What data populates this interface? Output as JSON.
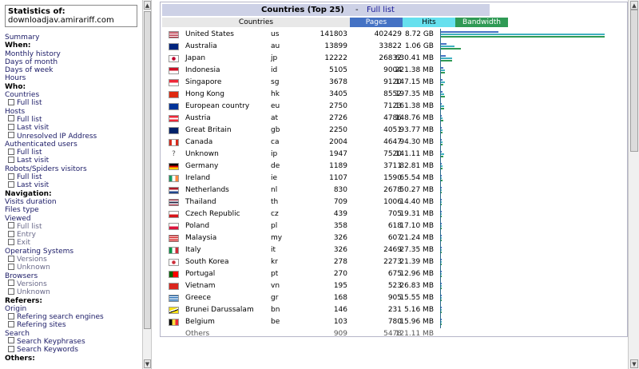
{
  "sidebar": {
    "stats_label": "Statistics of:",
    "site": "downloadjav.amirariff.com",
    "items": [
      {
        "type": "lk",
        "text": "Summary"
      },
      {
        "type": "hd",
        "text": "When:"
      },
      {
        "type": "lk",
        "text": "Monthly history"
      },
      {
        "type": "lk",
        "text": "Days of month"
      },
      {
        "type": "lk",
        "text": "Days of week"
      },
      {
        "type": "lk",
        "text": "Hours"
      },
      {
        "type": "hd",
        "text": "Who:"
      },
      {
        "type": "lk",
        "text": "Countries"
      },
      {
        "type": "sub",
        "text": "Full list"
      },
      {
        "type": "lk",
        "text": "Hosts"
      },
      {
        "type": "sub",
        "text": "Full list"
      },
      {
        "type": "sub",
        "text": "Last visit"
      },
      {
        "type": "sub",
        "text": "Unresolved IP Address"
      },
      {
        "type": "lk",
        "text": "Authenticated users"
      },
      {
        "type": "sub",
        "text": "Full list"
      },
      {
        "type": "sub",
        "text": "Last visit"
      },
      {
        "type": "lk",
        "text": "Robots/Spiders visitors"
      },
      {
        "type": "sub",
        "text": "Full list"
      },
      {
        "type": "sub",
        "text": "Last visit"
      },
      {
        "type": "hd",
        "text": "Navigation:"
      },
      {
        "type": "lk",
        "text": "Visits duration"
      },
      {
        "type": "lk",
        "text": "Files type"
      },
      {
        "type": "lk",
        "text": "Viewed"
      },
      {
        "type": "subgr",
        "text": "Full list"
      },
      {
        "type": "subgr",
        "text": "Entry"
      },
      {
        "type": "subgr",
        "text": "Exit"
      },
      {
        "type": "lk",
        "text": "Operating Systems"
      },
      {
        "type": "subgr",
        "text": "Versions"
      },
      {
        "type": "subgr",
        "text": "Unknown"
      },
      {
        "type": "lk",
        "text": "Browsers"
      },
      {
        "type": "subgr",
        "text": "Versions"
      },
      {
        "type": "subgr",
        "text": "Unknown"
      },
      {
        "type": "hd",
        "text": "Referers:"
      },
      {
        "type": "lk",
        "text": "Origin"
      },
      {
        "type": "sub",
        "text": "Refering search engines"
      },
      {
        "type": "sub",
        "text": "Refering sites"
      },
      {
        "type": "lk",
        "text": "Search"
      },
      {
        "type": "sub",
        "text": "Search Keyphrases"
      },
      {
        "type": "sub",
        "text": "Search Keywords"
      },
      {
        "type": "hd",
        "text": "Others:"
      }
    ]
  },
  "panel": {
    "title": "Countries (Top 25)",
    "separator": "-",
    "full_list_label": "Full list",
    "columns": {
      "countries": "Countries",
      "pages": "Pages",
      "hits": "Hits",
      "bandwidth": "Bandwidth"
    }
  },
  "colors": {
    "pages": "#4472c4",
    "hits": "#66e0ee",
    "bandwidth": "#2f9a55",
    "title_bg": "#cdd1e6"
  },
  "rows": [
    {
      "name": "United States",
      "code": "us",
      "pages": "141803",
      "hits": "402429",
      "bw": "8.72 GB",
      "flag": "us",
      "pv": 141803,
      "hv": 402429,
      "bv": 8929
    },
    {
      "name": "Australia",
      "code": "au",
      "pages": "13899",
      "hits": "33822",
      "bw": "1.06 GB",
      "flag": "au",
      "pv": 13899,
      "hv": 33822,
      "bv": 1085
    },
    {
      "name": "Japan",
      "code": "jp",
      "pages": "12222",
      "hits": "26832",
      "bw": "630.41 MB",
      "flag": "jp",
      "pv": 12222,
      "hv": 26832,
      "bv": 630.41
    },
    {
      "name": "Indonesia",
      "code": "id",
      "pages": "5105",
      "hits": "9004",
      "bw": "221.38 MB",
      "flag": "id",
      "pv": 5105,
      "hv": 9004,
      "bv": 221.38
    },
    {
      "name": "Singapore",
      "code": "sg",
      "pages": "3678",
      "hits": "9120",
      "bw": "147.15 MB",
      "flag": "sg",
      "pv": 3678,
      "hv": 9120,
      "bv": 147.15
    },
    {
      "name": "Hong Kong",
      "code": "hk",
      "pages": "3405",
      "hits": "8552",
      "bw": "197.35 MB",
      "flag": "hk",
      "pv": 3405,
      "hv": 8552,
      "bv": 197.35
    },
    {
      "name": "European country",
      "code": "eu",
      "pages": "2750",
      "hits": "7123",
      "bw": "161.38 MB",
      "flag": "eu",
      "pv": 2750,
      "hv": 7123,
      "bv": 161.38
    },
    {
      "name": "Austria",
      "code": "at",
      "pages": "2726",
      "hits": "4786",
      "bw": "148.76 MB",
      "flag": "at",
      "pv": 2726,
      "hv": 4786,
      "bv": 148.76
    },
    {
      "name": "Great Britain",
      "code": "gb",
      "pages": "2250",
      "hits": "4051",
      "bw": "93.77 MB",
      "flag": "gb",
      "pv": 2250,
      "hv": 4051,
      "bv": 93.77
    },
    {
      "name": "Canada",
      "code": "ca",
      "pages": "2004",
      "hits": "4647",
      "bw": "94.30 MB",
      "flag": "ca",
      "pv": 2004,
      "hv": 4647,
      "bv": 94.3
    },
    {
      "name": "Unknown",
      "code": "ip",
      "pages": "1947",
      "hits": "7520",
      "bw": "141.11 MB",
      "flag": "unknown",
      "pv": 1947,
      "hv": 7520,
      "bv": 141.11
    },
    {
      "name": "Germany",
      "code": "de",
      "pages": "1189",
      "hits": "3711",
      "bw": "82.81 MB",
      "flag": "de",
      "pv": 1189,
      "hv": 3711,
      "bv": 82.81
    },
    {
      "name": "Ireland",
      "code": "ie",
      "pages": "1107",
      "hits": "1590",
      "bw": "65.54 MB",
      "flag": "ie",
      "pv": 1107,
      "hv": 1590,
      "bv": 65.54
    },
    {
      "name": "Netherlands",
      "code": "nl",
      "pages": "830",
      "hits": "2678",
      "bw": "50.27 MB",
      "flag": "nl",
      "pv": 830,
      "hv": 2678,
      "bv": 50.27
    },
    {
      "name": "Thailand",
      "code": "th",
      "pages": "709",
      "hits": "1006",
      "bw": "14.40 MB",
      "flag": "th",
      "pv": 709,
      "hv": 1006,
      "bv": 14.4
    },
    {
      "name": "Czech Republic",
      "code": "cz",
      "pages": "439",
      "hits": "705",
      "bw": "19.31 MB",
      "flag": "cz",
      "pv": 439,
      "hv": 705,
      "bv": 19.31
    },
    {
      "name": "Poland",
      "code": "pl",
      "pages": "358",
      "hits": "618",
      "bw": "17.10 MB",
      "flag": "pl",
      "pv": 358,
      "hv": 618,
      "bv": 17.1
    },
    {
      "name": "Malaysia",
      "code": "my",
      "pages": "326",
      "hits": "607",
      "bw": "21.24 MB",
      "flag": "my",
      "pv": 326,
      "hv": 607,
      "bv": 21.24
    },
    {
      "name": "Italy",
      "code": "it",
      "pages": "326",
      "hits": "2469",
      "bw": "27.35 MB",
      "flag": "it",
      "pv": 326,
      "hv": 2469,
      "bv": 27.35
    },
    {
      "name": "South Korea",
      "code": "kr",
      "pages": "278",
      "hits": "2273",
      "bw": "21.39 MB",
      "flag": "kr",
      "pv": 278,
      "hv": 2273,
      "bv": 21.39
    },
    {
      "name": "Portugal",
      "code": "pt",
      "pages": "270",
      "hits": "675",
      "bw": "12.96 MB",
      "flag": "pt",
      "pv": 270,
      "hv": 675,
      "bv": 12.96
    },
    {
      "name": "Vietnam",
      "code": "vn",
      "pages": "195",
      "hits": "523",
      "bw": "26.83 MB",
      "flag": "vn",
      "pv": 195,
      "hv": 523,
      "bv": 26.83
    },
    {
      "name": "Greece",
      "code": "gr",
      "pages": "168",
      "hits": "905",
      "bw": "15.55 MB",
      "flag": "gr",
      "pv": 168,
      "hv": 905,
      "bv": 15.55
    },
    {
      "name": "Brunei Darussalam",
      "code": "bn",
      "pages": "146",
      "hits": "231",
      "bw": "5.16 MB",
      "flag": "bn",
      "pv": 146,
      "hv": 231,
      "bv": 5.16
    },
    {
      "name": "Belgium",
      "code": "be",
      "pages": "103",
      "hits": "780",
      "bw": "15.96 MB",
      "flag": "be",
      "pv": 103,
      "hv": 780,
      "bv": 15.96
    }
  ],
  "others": {
    "name": "Others",
    "pages": "909",
    "hits": "5478",
    "bw": "121.11 MB"
  }
}
